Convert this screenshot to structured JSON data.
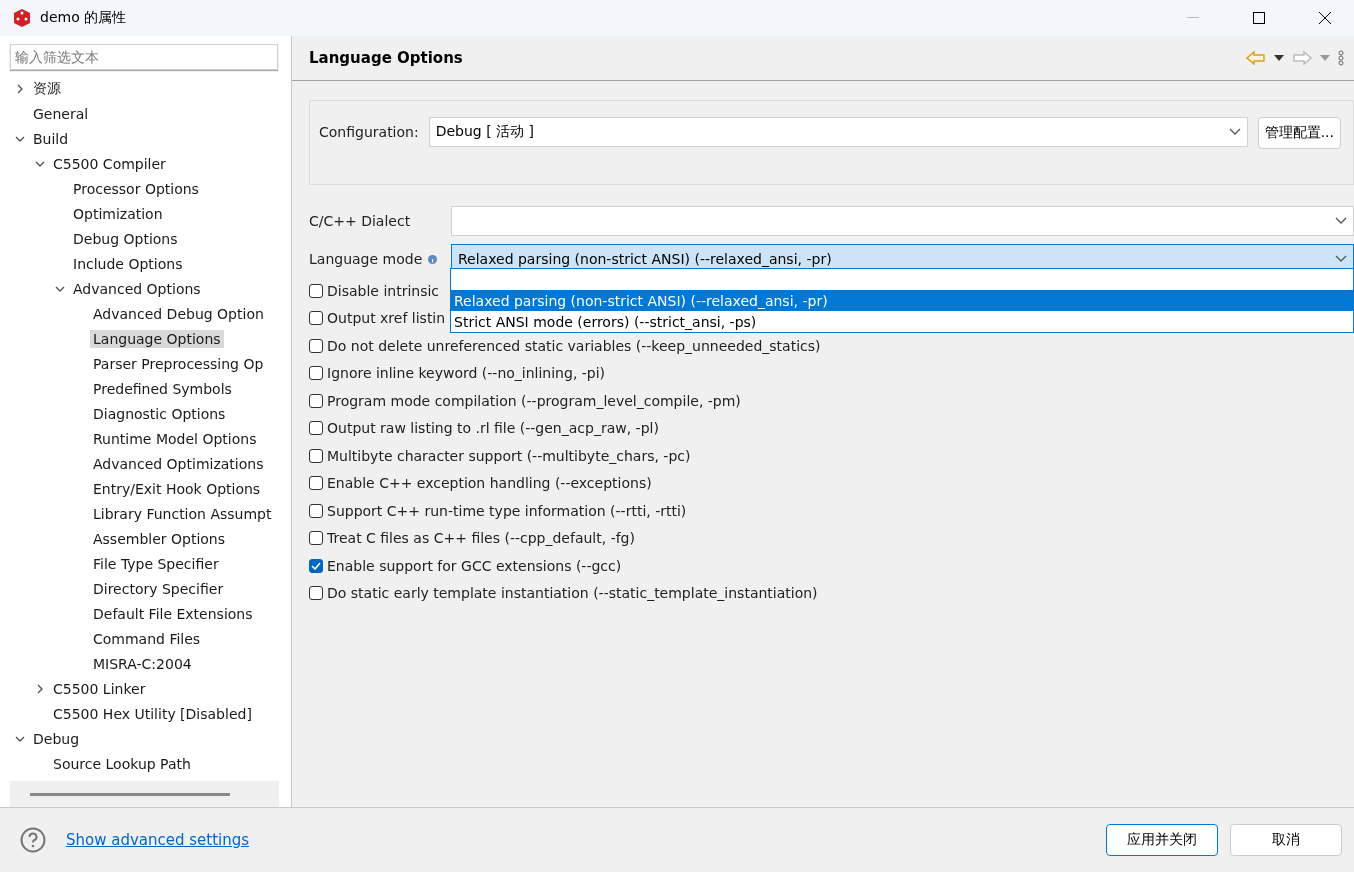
{
  "window": {
    "title": "demo 的属性"
  },
  "filter": {
    "placeholder": "输入筛选文本"
  },
  "tree": [
    {
      "label": "资源",
      "expanded": false,
      "selected": false
    },
    {
      "label": "General",
      "selected": false
    },
    {
      "label": "Build",
      "expanded": true,
      "selected": false,
      "children": [
        {
          "label": "C5500 Compiler",
          "expanded": true,
          "selected": false,
          "children": [
            {
              "label": "Processor Options",
              "selected": false
            },
            {
              "label": "Optimization",
              "selected": false
            },
            {
              "label": "Debug Options",
              "selected": false
            },
            {
              "label": "Include Options",
              "selected": false
            },
            {
              "label": "Advanced Options",
              "expanded": true,
              "selected": false,
              "children": [
                {
                  "label": "Advanced Debug Option",
                  "selected": false
                },
                {
                  "label": "Language Options",
                  "selected": true
                },
                {
                  "label": "Parser Preprocessing Op",
                  "selected": false
                },
                {
                  "label": "Predefined Symbols",
                  "selected": false
                },
                {
                  "label": "Diagnostic Options",
                  "selected": false
                },
                {
                  "label": "Runtime Model Options",
                  "selected": false
                },
                {
                  "label": "Advanced Optimizations",
                  "selected": false
                },
                {
                  "label": "Entry/Exit Hook Options",
                  "selected": false
                },
                {
                  "label": "Library Function Assumpt",
                  "selected": false
                },
                {
                  "label": "Assembler Options",
                  "selected": false
                },
                {
                  "label": "File Type Specifier",
                  "selected": false
                },
                {
                  "label": "Directory Specifier",
                  "selected": false
                },
                {
                  "label": "Default File Extensions",
                  "selected": false
                },
                {
                  "label": "Command Files",
                  "selected": false
                },
                {
                  "label": "MISRA-C:2004",
                  "selected": false
                }
              ]
            }
          ]
        },
        {
          "label": "C5500 Linker",
          "expanded": false,
          "selected": false
        },
        {
          "label": "C5500 Hex Utility  [Disabled]",
          "selected": false
        }
      ]
    },
    {
      "label": "Debug",
      "expanded": true,
      "selected": false,
      "children": [
        {
          "label": "Source Lookup Path",
          "selected": false
        }
      ]
    }
  ],
  "page": {
    "title": "Language Options"
  },
  "configuration": {
    "label": "Configuration:",
    "value": "Debug  [ 活动 ]",
    "button": "管理配置..."
  },
  "dialect": {
    "label": "C/C++ Dialect"
  },
  "language_mode": {
    "label": "Language mode",
    "value": "Relaxed parsing (non-strict ANSI) (--relaxed_ansi, -pr)",
    "expanded": true,
    "options": [
      {
        "selected": false
      },
      {
        "label": "Relaxed parsing (non-strict ANSI) (--relaxed_ansi, -pr)",
        "selected": true
      },
      {
        "label": "Strict ANSI mode (errors) (--strict_ansi, -ps)",
        "selected": false
      }
    ]
  },
  "checkboxes": [
    {
      "label": "Disable intrinsic",
      "checked": false
    },
    {
      "label": "Output xref listin",
      "checked": false
    },
    {
      "label": "Do not delete unreferenced static variables (--keep_unneeded_statics)",
      "checked": false
    },
    {
      "label": "Ignore inline keyword (--no_inlining, -pi)",
      "checked": false
    },
    {
      "label": "Program mode compilation (--program_level_compile, -pm)",
      "checked": false
    },
    {
      "label": "Output raw listing to .rl file (--gen_acp_raw, -pl)",
      "checked": false
    },
    {
      "label": "Multibyte character support (--multibyte_chars, -pc)",
      "checked": false
    },
    {
      "label": "Enable C++ exception handling (--exceptions)",
      "checked": false
    },
    {
      "label": "Support C++ run-time type information (--rtti, -rtti)",
      "checked": false
    },
    {
      "label": "Treat C files as C++ files (--cpp_default, -fg)",
      "checked": false
    },
    {
      "label": "Enable support for GCC extensions (--gcc)",
      "checked": true
    },
    {
      "label": "Do static early template instantiation (--static_template_instantiation)",
      "checked": false
    }
  ],
  "footer": {
    "link": "Show advanced settings",
    "buttons": [
      {
        "label": "应用并关闭",
        "kind": "default"
      },
      {
        "label": "取消",
        "kind": "normal"
      }
    ]
  }
}
